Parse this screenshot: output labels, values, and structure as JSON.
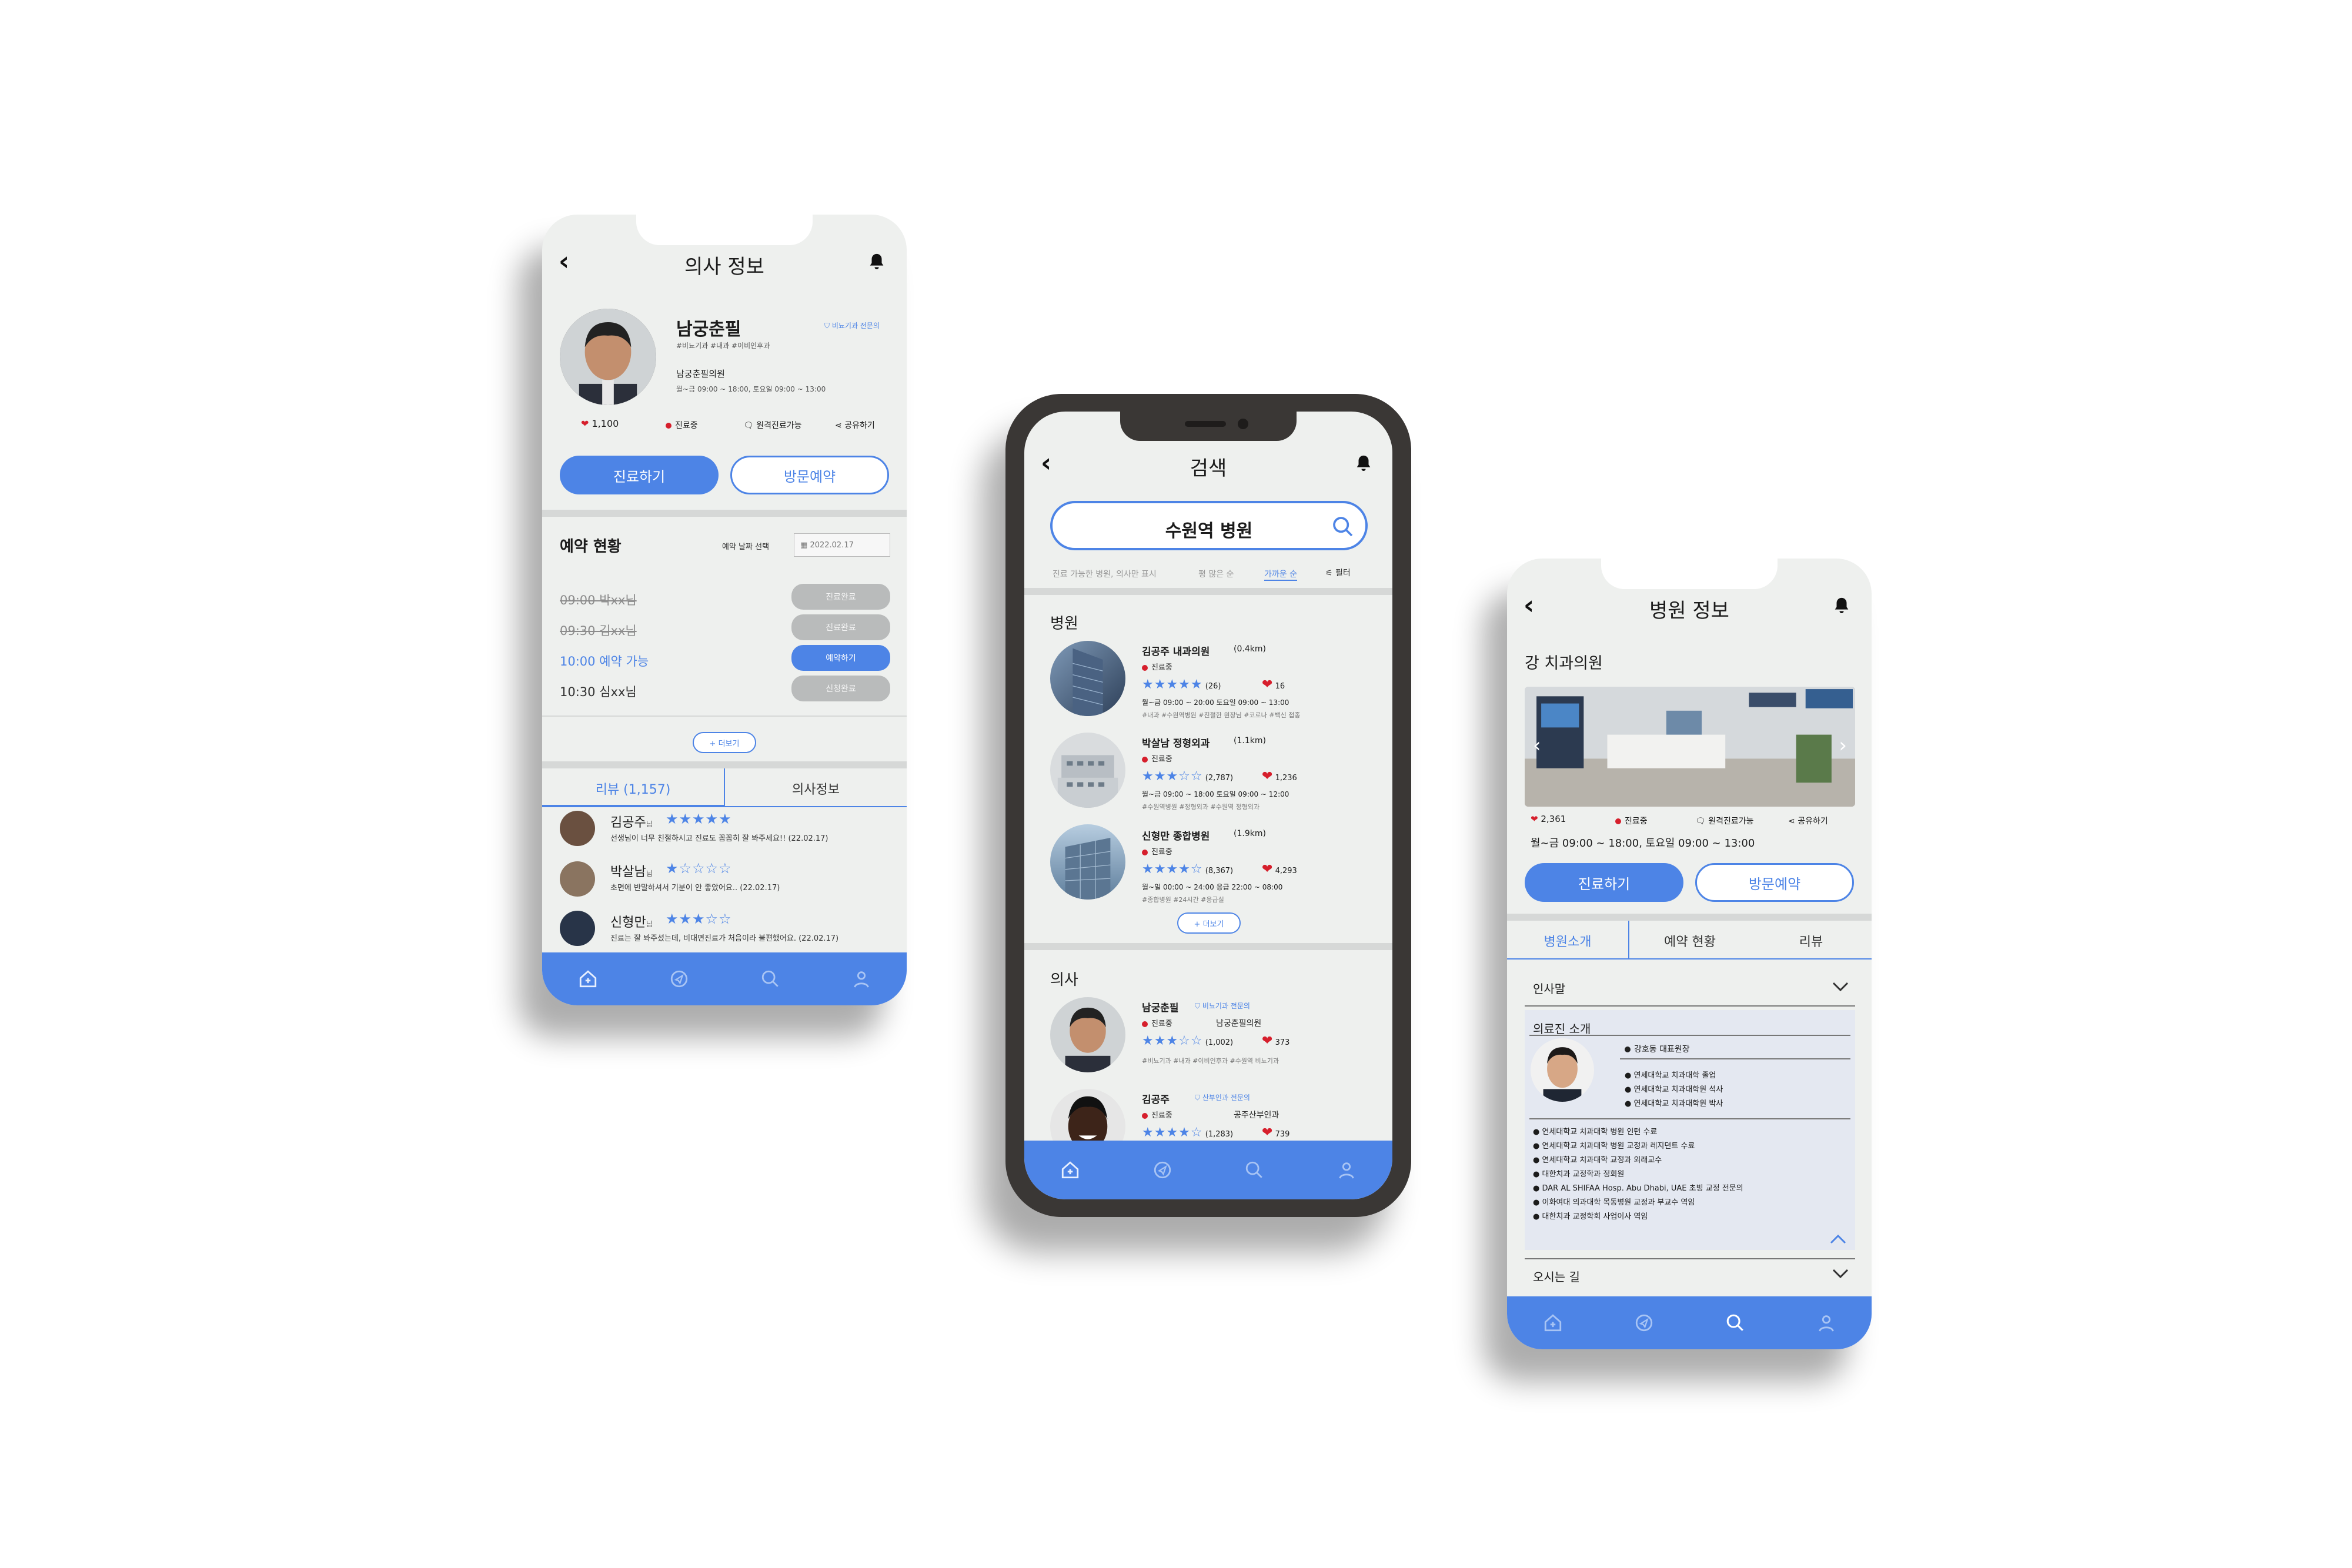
{
  "colors": {
    "accent": "#4d84e6",
    "live": "#d61f2c",
    "bg": "#eef0ee"
  },
  "doctor_screen": {
    "title": "의사 정보",
    "name": "남궁춘필",
    "specialist_badge": "비뇨기과 전문의",
    "tags": "#비뇨기과 #내과 #이비인후과",
    "clinic": "남궁춘필의원",
    "hours": "월~금 09:00 ~ 18:00, 토요일 09:00 ~ 13:00",
    "likes": "1,100",
    "status": "진료중",
    "remote": "원격진료가능",
    "share": "공유하기",
    "btn_treat": "진료하기",
    "btn_visit": "방문예약",
    "reservation_title": "예약 현황",
    "date_label": "예약 날짜 선택",
    "date_value": "2022.02.17",
    "slots": [
      {
        "time": "09:00 박xx님",
        "action": "진료완료"
      },
      {
        "time": "09:30 김xx님",
        "action": "진료완료"
      },
      {
        "time": "10:00 예약 가능",
        "action": "예약하기"
      },
      {
        "time": "10:30 심xx님",
        "action": "신청완료"
      }
    ],
    "more": "+ 더보기",
    "tab_review": "리뷰 (1,157)",
    "tab_info": "의사정보",
    "reviews": [
      {
        "name": "김공주",
        "suffix": "님",
        "stars": "★★★★★",
        "text": "선생님이 너무 친절하시고 진료도 꼼꼼히 잘 봐주세요!! (22.02.17)"
      },
      {
        "name": "박살남",
        "suffix": "님",
        "stars": "★☆☆☆☆",
        "text": "초면에 반말하셔서 기분이 안 좋았어요.. (22.02.17)"
      },
      {
        "name": "신형만",
        "suffix": "님",
        "stars": "★★★☆☆",
        "text": "진료는 잘 봐주셨는데, 비대면진료가 처음이라 불편했어요. (22.02.17)"
      }
    ]
  },
  "search_screen": {
    "title": "검색",
    "query": "수원역 병원",
    "filters": {
      "hint": "진료 가능한 병원, 의사만 표시",
      "f1": "평 많은 순",
      "f2": "가까운 순",
      "f3": "필터"
    },
    "hospital_section": "병원",
    "hospitals": [
      {
        "name": "김공주 내과의원",
        "dist": "(0.4km)",
        "status": "진료중",
        "stars": "★★★★★",
        "reviews": "(26)",
        "likes": "16",
        "hours": "월~금 09:00 ~ 20:00 토요일 09:00 ~ 13:00",
        "tags": "#내과 #수원역병원 #친절한 원장님 #코로나 #백신 접종"
      },
      {
        "name": "박살남 정형외과",
        "dist": "(1.1km)",
        "status": "진료중",
        "stars": "★★★☆☆",
        "reviews": "(2,787)",
        "likes": "1,236",
        "hours": "월~금 09:00 ~ 18:00 토요일 09:00 ~ 12:00",
        "tags": "#수원역병원 #정형외과 #수원역 정형외과"
      },
      {
        "name": "신형만 종합병원",
        "dist": "(1.9km)",
        "status": "진료중",
        "stars": "★★★★☆",
        "reviews": "(8,367)",
        "likes": "4,293",
        "hours": "월~일 00:00 ~ 24:00 응급 22:00 ~ 08:00",
        "tags": "#종합병원 #24시간 #응급실"
      }
    ],
    "more": "+ 더보기",
    "doctor_section": "의사",
    "doctors": [
      {
        "name": "남궁춘필",
        "badge": "비뇨기과 전문의",
        "status": "진료중",
        "clinic": "남궁춘필의원",
        "stars": "★★★☆☆",
        "reviews": "(1,002)",
        "likes": "373",
        "tags": "#비뇨기과 #내과 #이비인후과 #수원역 비뇨기과"
      },
      {
        "name": "김공주",
        "badge": "산부인과 전문의",
        "status": "진료중",
        "clinic": "공주산부인과",
        "stars": "★★★★☆",
        "reviews": "(1,283)",
        "likes": "739"
      }
    ]
  },
  "hospital_screen": {
    "title": "병원 정보",
    "name": "강 치과의원",
    "likes": "2,361",
    "status": "진료중",
    "remote": "원격진료가능",
    "share": "공유하기",
    "hours": "월~금 09:00 ~ 18:00, 토요일 09:00 ~ 13:00",
    "btn_treat": "진료하기",
    "btn_visit": "방문예약",
    "tabs": [
      "병원소개",
      "예약 현황",
      "리뷰"
    ],
    "greeting": "인사말",
    "staff_title": "의료진 소개",
    "director": "강호동 대표원장",
    "edu": [
      "연세대학교 치과대학 졸업",
      "연세대학교 치과대학원 석사",
      "연세대학교 치과대학원 박사"
    ],
    "career": [
      "연세대학교 치과대학 병원 인턴 수료",
      "연세대학교 치과대학 병원 교정과 레지던트 수료",
      "연세대학교 치과대학 교정과 외래교수",
      "대한치과 교정학과 정회원",
      "DAR AL SHIFAA Hosp. Abu Dhabi, UAE 초빙 교정 전문의",
      "이화여대 의과대학 목동병원 교정과 부교수 역임",
      "대한치과 교정학회 사업이사 역임"
    ],
    "directions": "오시는 길"
  }
}
